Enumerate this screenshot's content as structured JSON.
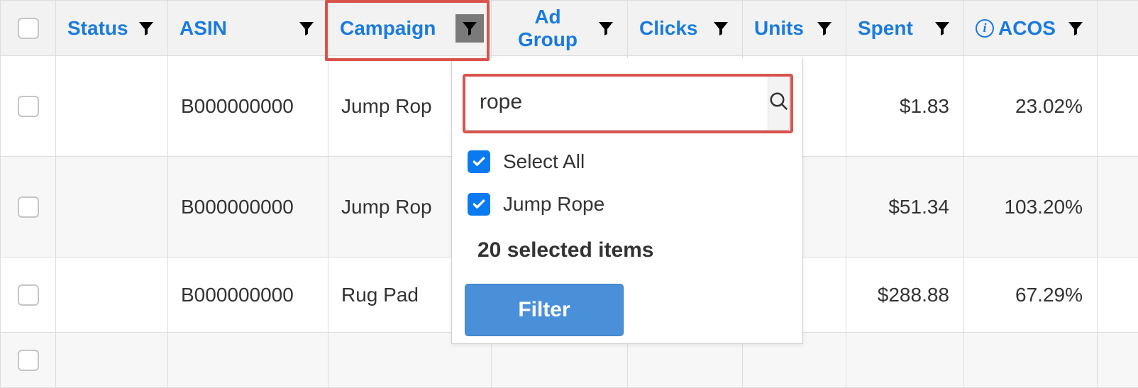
{
  "headers": {
    "status": "Status",
    "asin": "ASIN",
    "campaign": "Campaign",
    "adgroup": "Ad Group",
    "clicks": "Clicks",
    "units": "Units",
    "spent": "Spent",
    "acos": "ACOS"
  },
  "rows": [
    {
      "asin": "B000000000",
      "campaign": "Jump Rop",
      "spent": "$1.83",
      "acos": "23.02%"
    },
    {
      "asin": "B000000000",
      "campaign": "Jump Rop",
      "spent": "$51.34",
      "acos": "103.20%"
    },
    {
      "asin": "B000000000",
      "campaign": "Rug Pad",
      "spent": "$288.88",
      "acos": "67.29%"
    }
  ],
  "filter": {
    "search_value": "rope",
    "select_all_label": "Select All",
    "option1_label": "Jump Rope",
    "selected_count_text": "20 selected items",
    "filter_button": "Filter"
  }
}
